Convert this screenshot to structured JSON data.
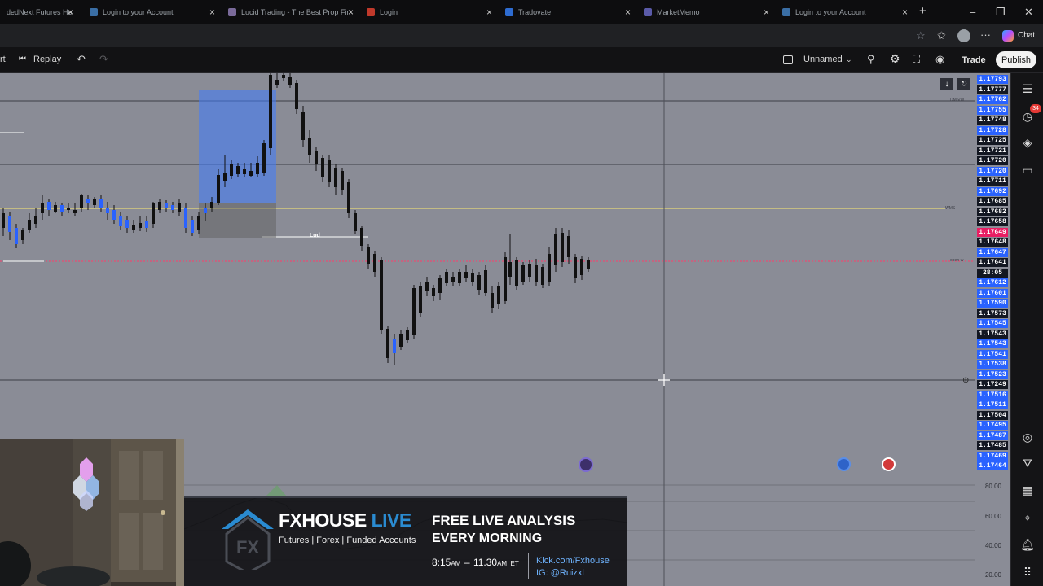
{
  "browser": {
    "tabs": [
      {
        "title": "dedNext Futures Hel",
        "favicon_color": "#4a4f5a"
      },
      {
        "title": "Login to your Account",
        "favicon_color": "#3a6ea5"
      },
      {
        "title": "Lucid Trading - The Best Prop Fir",
        "favicon_color": "#7a6a9a"
      },
      {
        "title": "Login",
        "favicon_color": "#c0392b"
      },
      {
        "title": "Tradovate",
        "favicon_color": "#2e6cd1"
      },
      {
        "title": "MarketMemo",
        "favicon_color": "#5a5aa8"
      },
      {
        "title": "Login to your Account",
        "favicon_color": "#3a6ea5"
      }
    ],
    "chat_label": "Chat"
  },
  "toolbar": {
    "left_partial": "rt",
    "replay_label": "Replay",
    "layout_name": "Unnamed",
    "trade_label": "Trade",
    "publish_label": "Publish"
  },
  "chart": {
    "price_labels": [
      {
        "v": "1.17793",
        "c": "#2962ff"
      },
      {
        "v": "1.17777",
        "c": "#131722"
      },
      {
        "v": "1.17762",
        "c": "#2962ff"
      },
      {
        "v": "1.17755",
        "c": "#2962ff"
      },
      {
        "v": "1.17748",
        "c": "#131722"
      },
      {
        "v": "1.17728",
        "c": "#2962ff"
      },
      {
        "v": "1.17725",
        "c": "#131722"
      },
      {
        "v": "1.17721",
        "c": "#131722"
      },
      {
        "v": "1.17720",
        "c": "#131722"
      },
      {
        "v": "1.17720",
        "c": "#2962ff"
      },
      {
        "v": "1.17711",
        "c": "#131722"
      },
      {
        "v": "1.17692",
        "c": "#2962ff"
      },
      {
        "v": "1.17685",
        "c": "#131722"
      },
      {
        "v": "1.17682",
        "c": "#131722"
      },
      {
        "v": "1.17658",
        "c": "#131722"
      },
      {
        "v": "1.17649",
        "c": "#e91e63"
      },
      {
        "v": "1.17648",
        "c": "#131722"
      },
      {
        "v": "1.17647",
        "c": "#2962ff"
      },
      {
        "v": "1.17641",
        "c": "#131722"
      },
      {
        "v": "28:05",
        "c": "#131722"
      },
      {
        "v": "1.17612",
        "c": "#2962ff"
      },
      {
        "v": "1.17601",
        "c": "#2962ff"
      },
      {
        "v": "1.17590",
        "c": "#2962ff"
      },
      {
        "v": "1.17573",
        "c": "#131722"
      },
      {
        "v": "1.17545",
        "c": "#2962ff"
      },
      {
        "v": "1.17543",
        "c": "#131722"
      },
      {
        "v": "1.17543",
        "c": "#2962ff"
      },
      {
        "v": "1.17541",
        "c": "#2962ff"
      },
      {
        "v": "1.17538",
        "c": "#2962ff"
      },
      {
        "v": "1.17523",
        "c": "#2962ff"
      },
      {
        "v": "1.17249",
        "c": "#131722"
      },
      {
        "v": "1.17516",
        "c": "#2962ff"
      },
      {
        "v": "1.17511",
        "c": "#2962ff"
      },
      {
        "v": "1.17504",
        "c": "#131722"
      },
      {
        "v": "1.17495",
        "c": "#2962ff"
      },
      {
        "v": "1.17487",
        "c": "#2962ff"
      },
      {
        "v": "1.17485",
        "c": "#131722"
      },
      {
        "v": "1.17469",
        "c": "#2962ff"
      },
      {
        "v": "1.17464",
        "c": "#2962ff"
      }
    ],
    "lod_label": "Lod",
    "line_tags": [
      "DMS/W",
      "WMS",
      "open-w"
    ],
    "indicator_levels": [
      "80.00",
      "60.00",
      "40.00",
      "20.00"
    ],
    "notification_count": "34"
  },
  "banner": {
    "brand": "FXHOUSE",
    "brand_live": "LIVE",
    "tagline": "Futures | Forex | Funded Accounts",
    "headline1": "FREE LIVE ANALYSIS",
    "headline2": "EVERY MORNING",
    "time_start": "8:15",
    "am1": "AM",
    "dash": "–",
    "time_end": "11.30",
    "am2": "AM",
    "tz": "ET",
    "kick": "Kick.com/Fxhouse",
    "ig": "IG: @Ruizxl"
  }
}
